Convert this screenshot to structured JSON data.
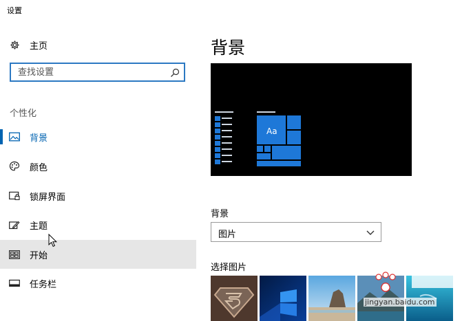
{
  "window": {
    "title": "设置"
  },
  "sidebar": {
    "home": {
      "label": "主页",
      "icon": "gear-icon"
    },
    "search": {
      "placeholder": "查找设置",
      "icon": "search-icon"
    },
    "section_title": "个性化",
    "items": [
      {
        "label": "背景",
        "icon": "picture-icon",
        "selected": true
      },
      {
        "label": "颜色",
        "icon": "palette-icon"
      },
      {
        "label": "锁屏界面",
        "icon": "lock-screen-icon"
      },
      {
        "label": "主题",
        "icon": "theme-icon"
      },
      {
        "label": "开始",
        "icon": "start-icon",
        "hover": true
      },
      {
        "label": "任务栏",
        "icon": "taskbar-icon"
      }
    ]
  },
  "main": {
    "title": "背景",
    "preview": {
      "tile_text": "Aa"
    },
    "background_label": "背景",
    "background_select": {
      "value": "图片"
    },
    "choose_label": "选择图片",
    "thumbnails": [
      "superman-logo",
      "windows-blue-light",
      "beach-rocks",
      "coast-cliffs",
      "underwater-diver"
    ]
  },
  "watermark": {
    "text": "jingyan.baidu.com",
    "logo": "Baidu经验"
  },
  "colors": {
    "accent": "#0063b1",
    "hover": "#e6e6e6",
    "tile": "#0a6fd6"
  }
}
